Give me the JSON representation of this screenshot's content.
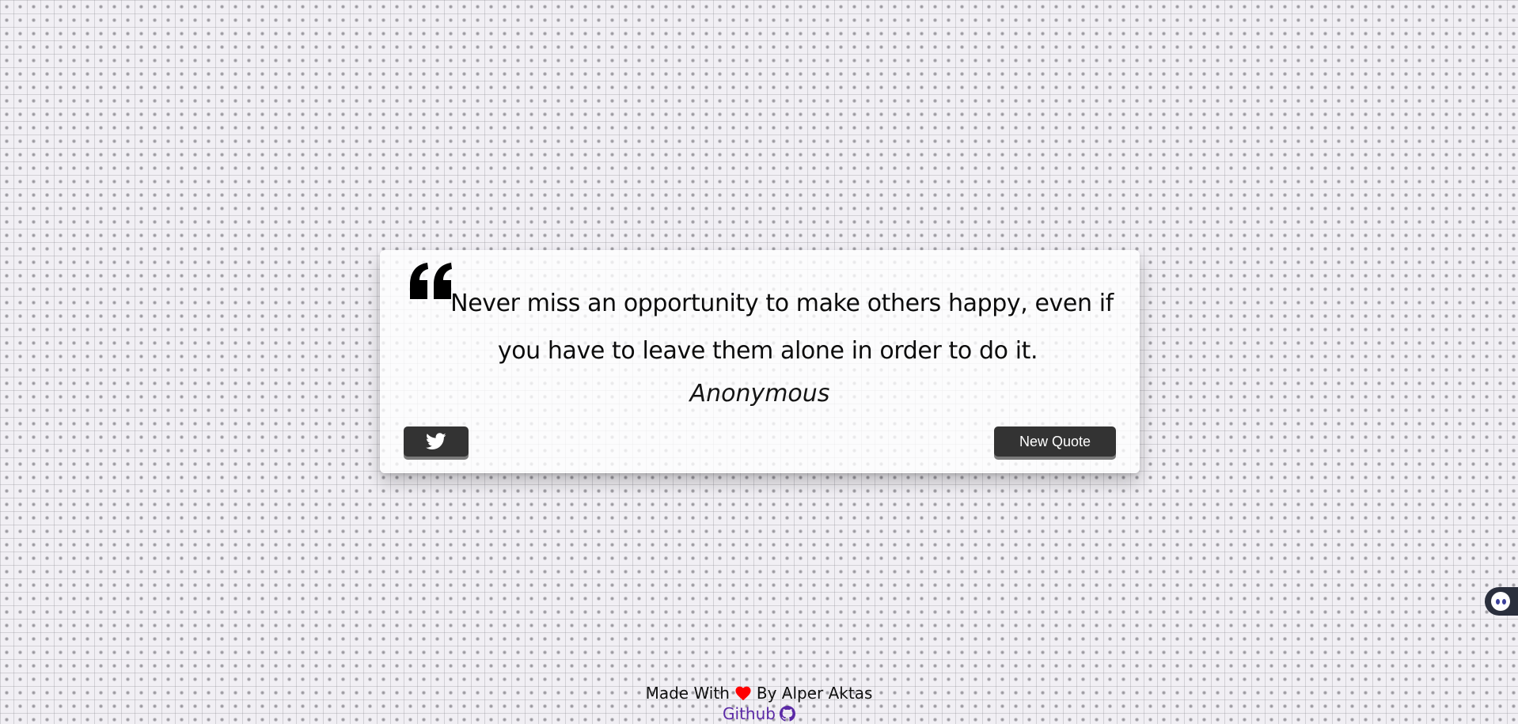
{
  "quote": {
    "text": "Never miss an opportunity to make others happy, even if you have to leave them alone in order to do it.",
    "author": "Anonymous"
  },
  "buttons": {
    "tweet_icon": "twitter-icon",
    "new_quote_label": "New Quote"
  },
  "footer": {
    "made_with": "Made With",
    "by_author": "By Alper Aktas",
    "github_label": "Github",
    "heart_color": "#ff0000",
    "link_color": "#5b2aa6"
  },
  "colors": {
    "background": "#f1eff4",
    "button": "#333333",
    "button_shadow": "#7a7a7a"
  },
  "side_widget": {
    "icon": "assistant-bot-icon"
  }
}
